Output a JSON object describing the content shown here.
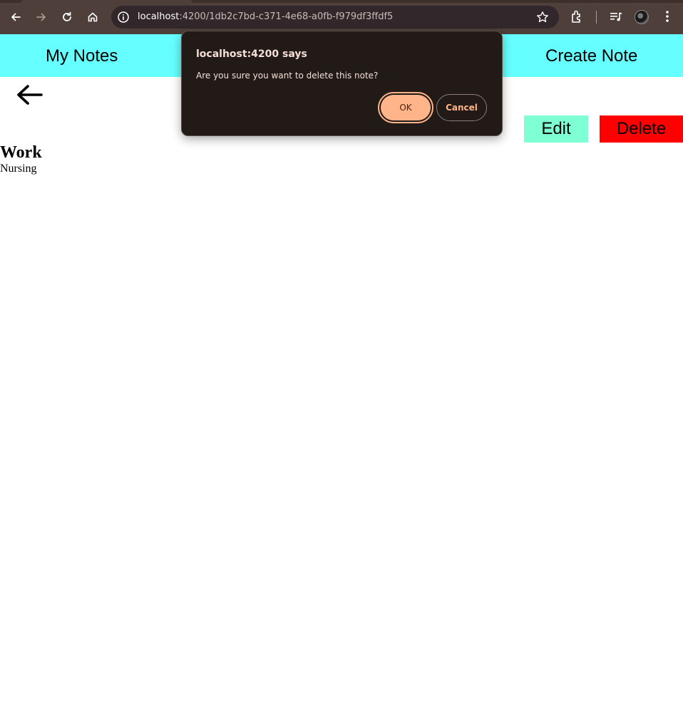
{
  "browser": {
    "url_host": "localhost",
    "url_path": ":4200/1db2c7bd-c371-4e68-a0fb-f979df3ffdf5",
    "icons": [
      "back-icon",
      "forward-icon",
      "reload-icon",
      "home-icon",
      "info-icon",
      "star-icon",
      "extensions-icon",
      "media-control-icon",
      "profile-avatar",
      "menu-icon"
    ]
  },
  "header": {
    "my_notes": "My Notes",
    "create_note": "Create Note",
    "background_color": "#66ffff"
  },
  "note": {
    "title": "Work",
    "body": "Nursing"
  },
  "actions": {
    "edit_label": "Edit",
    "delete_label": "Delete",
    "edit_color": "#7fffd4",
    "delete_color": "#ff0000"
  },
  "dialog": {
    "title": "localhost:4200 says",
    "message": "Are you sure you want to delete this note?",
    "ok_label": "OK",
    "cancel_label": "Cancel",
    "accent_color": "#ffb48a"
  }
}
